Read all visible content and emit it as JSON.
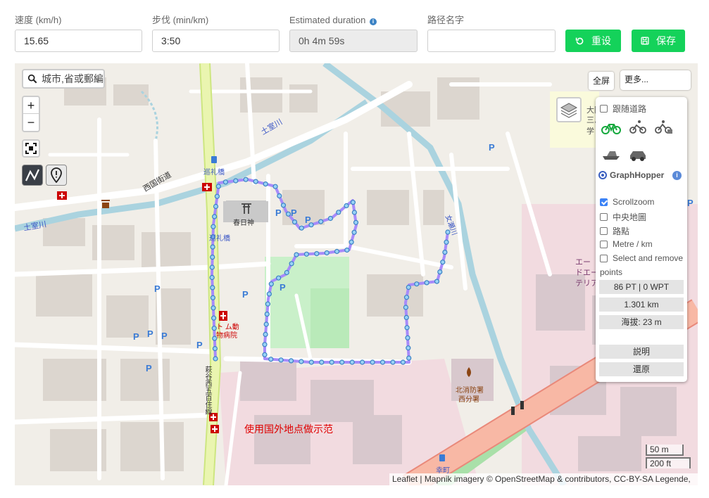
{
  "form": {
    "speed": {
      "label": "速度 (km/h)",
      "value": "15.65"
    },
    "pace": {
      "label": "步伐 (min/km)",
      "value": "3:50"
    },
    "duration": {
      "label": "Estimated duration",
      "value": "0h 4m 59s"
    },
    "route_name": {
      "label": "路径名字",
      "value": ""
    },
    "reset_label": "重设",
    "save_label": "保存"
  },
  "map": {
    "search_placeholder": "城市,省或郵編",
    "zoom_in": "+",
    "zoom_out": "−",
    "fullscreen_label": "全屏",
    "more_label": "更多...",
    "demo_text": "使用国外地点做示范",
    "attribution": "Leaflet | Mapnik imagery © OpenStreetMap & contributors, CC-BY-SA Legende,",
    "scale_metric": "50 m",
    "scale_imperial": "200 ft",
    "labels": {
      "shrine": "春日神",
      "bridge1": "巡礼橋",
      "bridge2": "巡礼橋",
      "road_west": "西国街道",
      "river": "土室川",
      "river2": "土室川",
      "street_vertical": "萩谷西五百住線",
      "hospital": "ト ム動\n物病院",
      "fire_station": "北消防署",
      "fire_station_sub": "西分署",
      "station": "幸町",
      "osaka1": "大阪",
      "osaka2": "三島",
      "osaka3": "学",
      "area1": "エー",
      "area2": "ドエー",
      "area3": "テリア",
      "river3": "女瀬川"
    }
  },
  "panel": {
    "follow_road": "跟随道路",
    "router_name": "GraphHopper",
    "scrollzoom": "Scrollzoom",
    "center_map": "中央地圖",
    "waypoints": "路點",
    "metre_km": "Metre / km",
    "select_remove": "Select and remove",
    "select_remove_2": "points",
    "count": "86 PT | 0 WPT",
    "distance": "1.301 km",
    "elevation": "海拔: 23 m",
    "help": "説明",
    "restore": "還原"
  },
  "colors": {
    "primary_green": "#14d25a",
    "route": "#a78bfa",
    "point_fill": "#9ad2f5"
  }
}
